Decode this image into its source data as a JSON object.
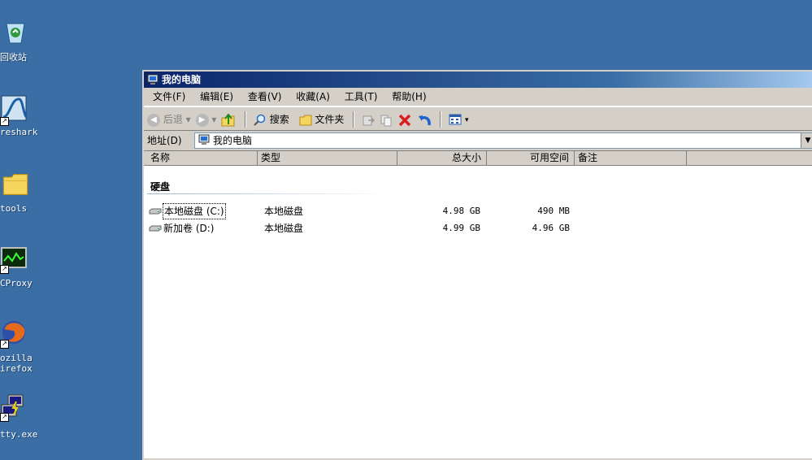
{
  "desktop": {
    "icons": [
      {
        "label": "回收站",
        "icon": "recycle-bin-icon"
      },
      {
        "label": "reshark",
        "icon": "wireshark-icon"
      },
      {
        "label": "tools",
        "icon": "folder-icon"
      },
      {
        "label": "CProxy",
        "icon": "ccproxy-icon"
      },
      {
        "label_line1": "ozilla",
        "label_line2": "irefox",
        "icon": "firefox-icon"
      },
      {
        "label": "tty.exe",
        "icon": "putty-icon"
      }
    ]
  },
  "window": {
    "title": "我的电脑",
    "menu": [
      "文件(F)",
      "编辑(E)",
      "查看(V)",
      "收藏(A)",
      "工具(T)",
      "帮助(H)"
    ],
    "toolbar": {
      "back": "后退",
      "search": "搜索",
      "folders": "文件夹"
    },
    "address": {
      "label": "地址(D)",
      "value": "我的电脑"
    },
    "columns": [
      "名称",
      "类型",
      "总大小",
      "可用空间",
      "备注"
    ],
    "group": "硬盘",
    "drives": [
      {
        "name": "本地磁盘 (C:)",
        "type": "本地磁盘",
        "total": "4.98 GB",
        "free": "490 MB"
      },
      {
        "name": "新加卷 (D:)",
        "type": "本地磁盘",
        "total": "4.99 GB",
        "free": "4.96 GB"
      }
    ]
  },
  "colors": {
    "desktop": "#3a6ea5",
    "titlebar": "#0a246a",
    "chrome": "#d4d0c8"
  }
}
